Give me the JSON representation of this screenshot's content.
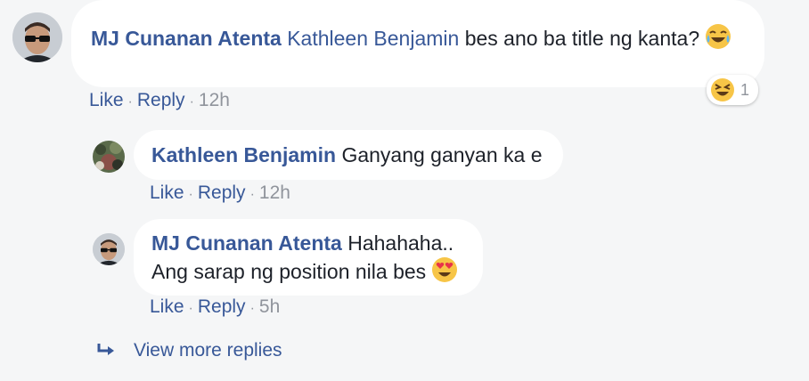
{
  "comments": [
    {
      "author": "MJ Cunanan Atenta",
      "mention": "Kathleen Benjamin",
      "text": "bes ano ba title ng kanta?",
      "emoji": "joy-emoji",
      "actions": {
        "like": "Like",
        "reply": "Reply",
        "time": "12h"
      },
      "reaction": {
        "emoji": "laughing-emoji",
        "count": "1"
      }
    }
  ],
  "replies": [
    {
      "author": "Kathleen Benjamin",
      "text": "Ganyang ganyan ka e",
      "actions": {
        "like": "Like",
        "reply": "Reply",
        "time": "12h"
      }
    },
    {
      "author": "MJ Cunanan Atenta",
      "text_line1": "Hahahaha..",
      "text_line2": "Ang sarap ng position nila bes",
      "emoji": "heart-eyes-emoji",
      "actions": {
        "like": "Like",
        "reply": "Reply",
        "time": "5h"
      }
    }
  ],
  "view_more": {
    "label": "View more replies",
    "icon": "reply-arrow-icon"
  },
  "colors": {
    "link": "#385898",
    "meta": "#90949c",
    "bubble": "#ffffff",
    "background": "#f5f6f7"
  }
}
